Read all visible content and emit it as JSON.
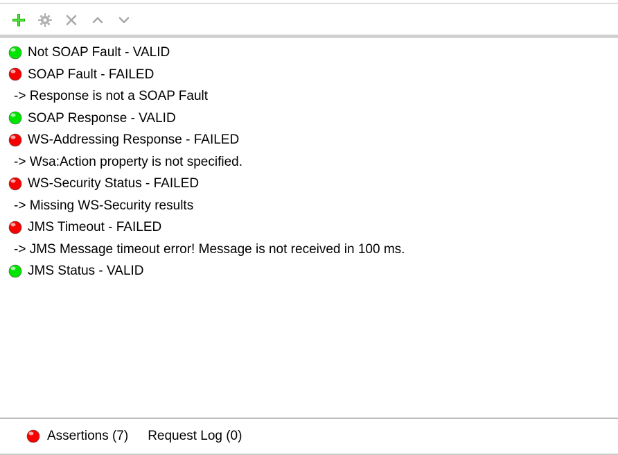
{
  "colors": {
    "green": "#00e400",
    "red": "#f60000",
    "grey": "#9e9e9e"
  },
  "toolbar": {
    "add_icon": "add-icon",
    "gear_icon": "gear-icon",
    "remove_icon": "remove-icon",
    "up_icon": "chevron-up-icon",
    "down_icon": "chevron-down-icon"
  },
  "assertions": [
    {
      "status": "valid",
      "label": "Not SOAP Fault - VALID"
    },
    {
      "status": "failed",
      "label": "SOAP Fault - FAILED",
      "detail": " -> Response is not a SOAP Fault"
    },
    {
      "status": "valid",
      "label": "SOAP Response - VALID"
    },
    {
      "status": "failed",
      "label": "WS-Addressing Response - FAILED",
      "detail": " -> Wsa:Action property is not specified."
    },
    {
      "status": "failed",
      "label": "WS-Security Status - FAILED",
      "detail": " -> Missing WS-Security results"
    },
    {
      "status": "failed",
      "label": "JMS Timeout - FAILED",
      "detail": " -> JMS Message timeout error! Message is not received in 100 ms."
    },
    {
      "status": "valid",
      "label": "JMS Status - VALID"
    }
  ],
  "tabs": {
    "assertions": {
      "label": "Assertions (7)",
      "status": "failed"
    },
    "request_log": {
      "label": "Request Log (0)"
    }
  }
}
